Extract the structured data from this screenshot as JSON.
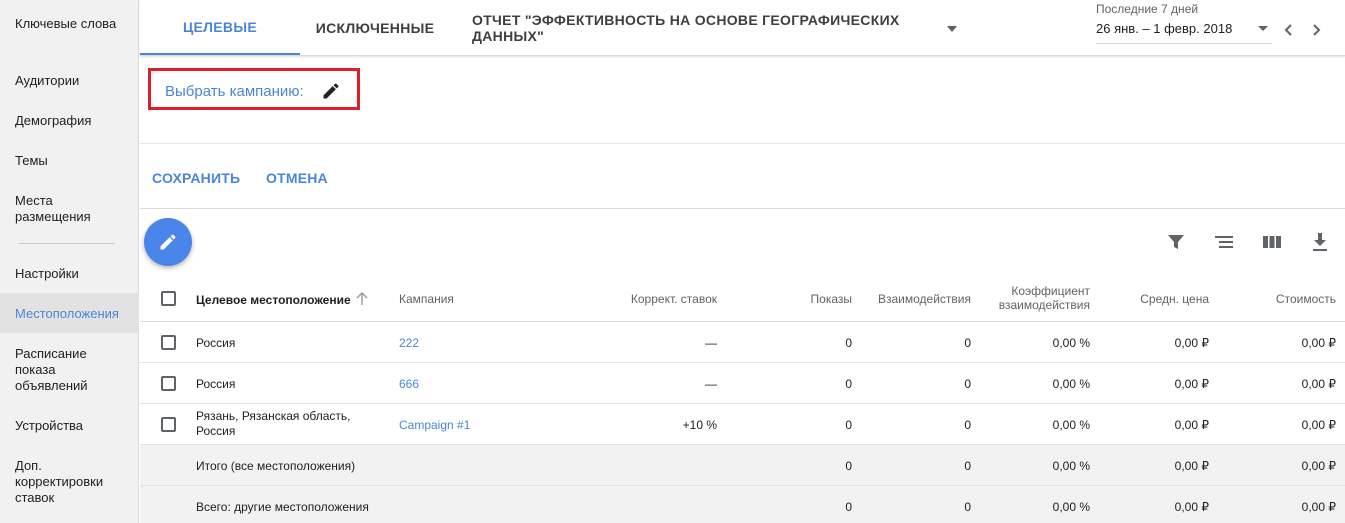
{
  "sidebar": {
    "items": [
      {
        "label": "Ключевые слова"
      },
      {
        "label": "Аудитории"
      },
      {
        "label": "Демография"
      },
      {
        "label": "Темы"
      },
      {
        "label": "Места размещения"
      },
      {
        "label": "Настройки"
      },
      {
        "label": "Местоположения",
        "active": true
      },
      {
        "label": "Расписание показа объявлений"
      },
      {
        "label": "Устройства"
      },
      {
        "label": "Доп. корректировки ставок"
      }
    ]
  },
  "tabs": [
    {
      "label": "ЦЕЛЕВЫЕ",
      "active": true
    },
    {
      "label": "ИСКЛЮЧЕННЫЕ"
    },
    {
      "label": "ОТЧЕТ \"ЭФФЕКТИВНОСТЬ НА ОСНОВЕ ГЕОГРАФИЧЕСКИХ ДАННЫХ\""
    }
  ],
  "date_range": {
    "label": "Последние 7 дней",
    "value": "26 янв. – 1 февр. 2018"
  },
  "campaign_selector": {
    "label": "Выбрать кампанию:"
  },
  "actions": {
    "save": "СОХРАНИТЬ",
    "cancel": "ОТМЕНА"
  },
  "icons": {
    "edit_fab": "pencil-icon",
    "filter": "filter-icon",
    "segment": "segment-icon",
    "columns": "columns-icon",
    "download": "download-icon"
  },
  "colors": {
    "accent": "#4a86d8",
    "highlight_box": "#e01e2a",
    "fab": "#4a86ea"
  },
  "table": {
    "columns": {
      "location": "Целевое местоположение",
      "campaign": "Кампания",
      "bid_adj": "Коррект. ставок",
      "impressions": "Показы",
      "interactions": "Взаимодействия",
      "interaction_rate_1": "Коэффициент",
      "interaction_rate_2": "взаимодействия",
      "avg_cost": "Средн. цена",
      "cost": "Стоимость"
    },
    "rows": [
      {
        "location": "Россия",
        "campaign": "222",
        "bid_adj": "—",
        "impressions": "0",
        "interactions": "0",
        "rate": "0,00 %",
        "avg_cost": "0,00 ₽",
        "cost": "0,00 ₽"
      },
      {
        "location": "Россия",
        "campaign": "666",
        "bid_adj": "—",
        "impressions": "0",
        "interactions": "0",
        "rate": "0,00 %",
        "avg_cost": "0,00 ₽",
        "cost": "0,00 ₽"
      },
      {
        "location": "Рязань, Рязанская область, Россия",
        "campaign": "Campaign #1",
        "bid_adj": "+10 %",
        "impressions": "0",
        "interactions": "0",
        "rate": "0,00 %",
        "avg_cost": "0,00 ₽",
        "cost": "0,00 ₽"
      }
    ],
    "totals": [
      {
        "label": "Итого (все местоположения)",
        "impressions": "0",
        "interactions": "0",
        "rate": "0,00 %",
        "avg_cost": "0,00 ₽",
        "cost": "0,00 ₽"
      },
      {
        "label": "Всего: другие местоположения",
        "impressions": "0",
        "interactions": "0",
        "rate": "0,00 %",
        "avg_cost": "0,00 ₽",
        "cost": "0,00 ₽"
      }
    ]
  }
}
